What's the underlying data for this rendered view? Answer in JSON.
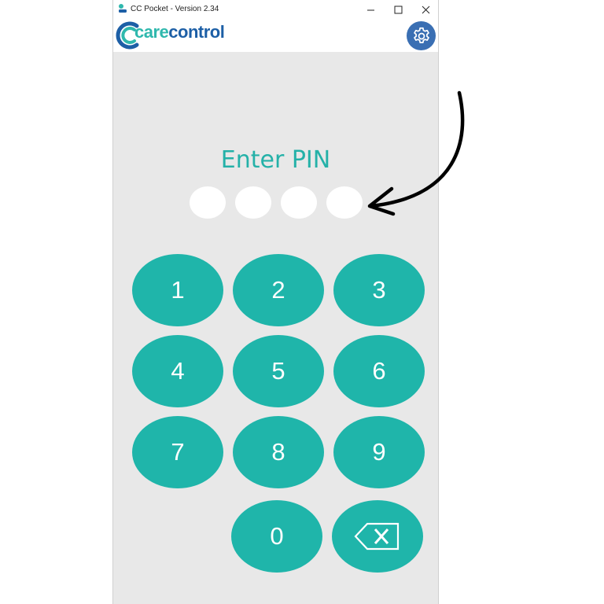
{
  "window": {
    "title": "CC Pocket - Version 2.34"
  },
  "logo": {
    "care": "care",
    "control": "control"
  },
  "pin": {
    "title": "Enter PIN",
    "digits_entered": 0,
    "digits_total": 4
  },
  "keypad": {
    "keys": [
      "1",
      "2",
      "3",
      "4",
      "5",
      "6",
      "7",
      "8",
      "9",
      "0"
    ]
  },
  "colors": {
    "teal": "#1fb5aa",
    "brand_blue": "#1d5fa6",
    "background": "#e8e8e8"
  },
  "icons": {
    "settings": "gear-icon",
    "backspace": "backspace-icon",
    "minimize": "minimize-icon",
    "maximize": "maximize-icon",
    "close": "close-icon"
  }
}
